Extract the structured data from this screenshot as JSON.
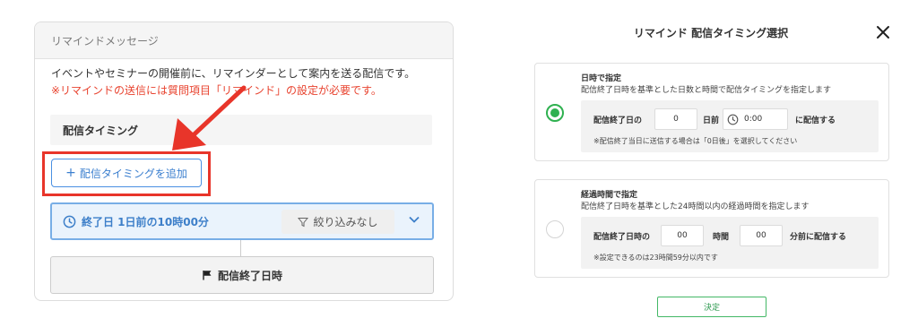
{
  "left": {
    "header": "リマインドメッセージ",
    "description": "イベントやセミナーの開催前に、リマインダーとして案内を送る配信です。",
    "warning": "※リマインドの送信には質問項目「リマインド」の設定が必要です。",
    "timing_section_title": "配信タイミング",
    "add_button": {
      "icon": "+",
      "label": "配信タイミングを追加"
    },
    "timing_item": {
      "label": "終了日 1日前の10時00分",
      "filter": "絞り込みなし"
    },
    "end_label": "配信終了日時"
  },
  "modal": {
    "title": "リマインド 配信タイミング選択",
    "option1": {
      "title": "日時で指定",
      "description": "配信終了日時を基準とした日数と時間で配信タイミングを指定します",
      "prefix": "配信終了日の",
      "days_value": "0",
      "days_unit": "日前",
      "time_value": "0:00",
      "suffix": "に配信する",
      "note": "※配信終了当日に送信する場合は「0日後」を選択してください",
      "selected": true
    },
    "option2": {
      "title": "経過時間で指定",
      "description": "配信終了日時を基準とした24時間以内の経過時間を指定します",
      "prefix": "配信終了日時の",
      "hours_value": "00",
      "hours_unit": "時間",
      "minutes_value": "00",
      "suffix": "分前に配信する",
      "note": "※設定できるのは23時間59分以内です",
      "selected": false
    },
    "decide_button": "決定"
  },
  "colors": {
    "accent_blue": "#3b7fcf",
    "highlight_red": "#e8352a",
    "warning_red": "#e8432f",
    "selected_green": "#2fb150"
  }
}
